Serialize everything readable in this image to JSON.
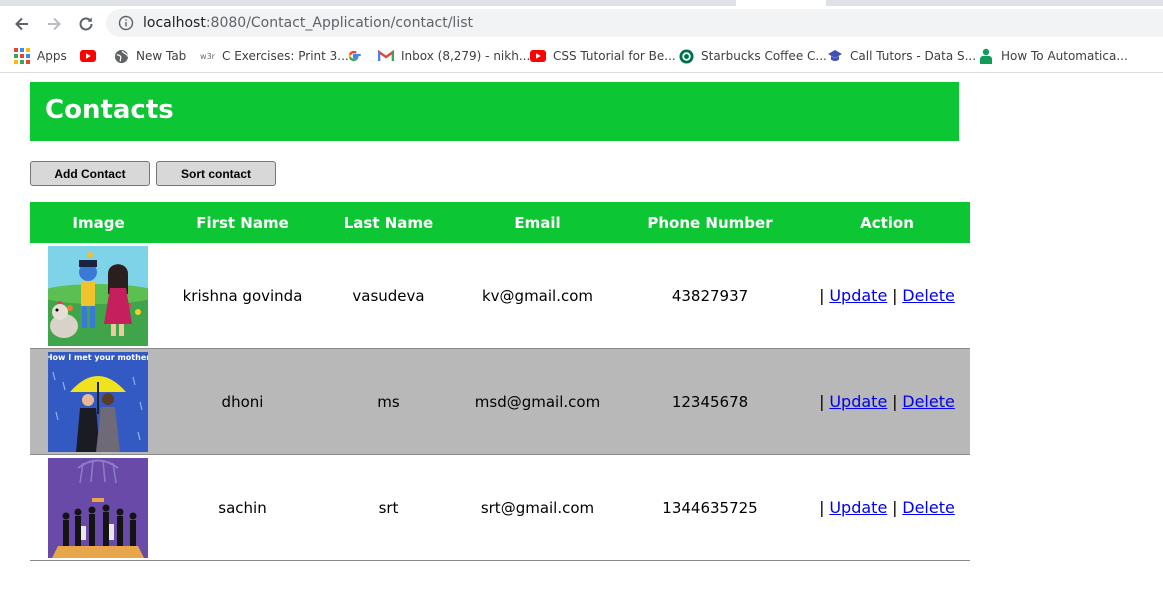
{
  "browser": {
    "url_host": "localhost",
    "url_path": ":8080/Contact_Application/contact/list",
    "bookmarks": [
      {
        "label": "Apps",
        "icon": "apps-grid-icon"
      },
      {
        "label": "",
        "icon": "youtube-icon"
      },
      {
        "label": "New Tab",
        "icon": "globe-icon"
      },
      {
        "label": "C Exercises: Print 3...",
        "icon": "w3r-icon"
      },
      {
        "label": "",
        "icon": "google-icon"
      },
      {
        "label": "Inbox (8,279) - nikh...",
        "icon": "gmail-icon"
      },
      {
        "label": "CSS Tutorial for Be...",
        "icon": "youtube-icon"
      },
      {
        "label": "Starbucks Coffee C...",
        "icon": "starbucks-icon"
      },
      {
        "label": "Call Tutors - Data S...",
        "icon": "graduation-cap-icon"
      },
      {
        "label": "How To Automatica...",
        "icon": "person-icon"
      }
    ],
    "w3r_text": "w3r"
  },
  "page": {
    "title": "Contacts",
    "buttons": {
      "add": "Add Contact",
      "sort": "Sort contact"
    },
    "table": {
      "headers": [
        "Image",
        "First Name",
        "Last Name",
        "Email",
        "Phone Number",
        "Action"
      ],
      "rows": [
        {
          "image": "cartoon-krishna-image",
          "first_name": "krishna govinda",
          "last_name": "vasudeva",
          "email": "kv@gmail.com",
          "phone": "43827937"
        },
        {
          "image": "how-i-met-your-mother-image",
          "first_name": "dhoni",
          "last_name": "ms",
          "email": "msd@gmail.com",
          "phone": "12345678"
        },
        {
          "image": "group-umbrella-image",
          "first_name": "sachin",
          "last_name": "srt",
          "email": "srt@gmail.com",
          "phone": "1344635725"
        }
      ],
      "action_separator": "|",
      "update_label": "Update",
      "delete_label": "Delete"
    },
    "image_texts": {
      "himym": "How I met your mother"
    }
  },
  "colors": {
    "accent": "#0cc633",
    "alt_row": "#b8b8b8",
    "link": "#0000ee"
  }
}
